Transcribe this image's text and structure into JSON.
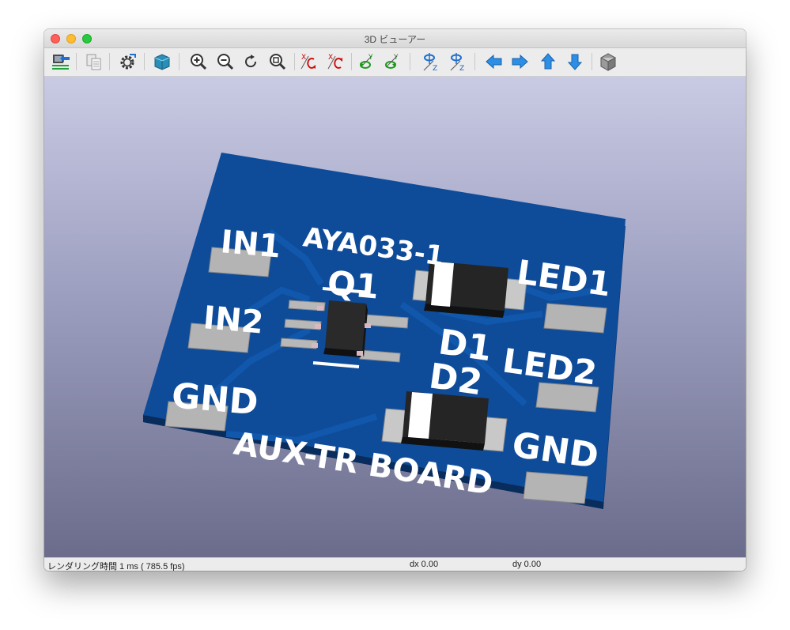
{
  "window": {
    "title": "3D ビューアー"
  },
  "toolbar": {
    "buttons": [
      {
        "id": "reload-board",
        "icon": "reload-board-icon",
        "tooltip": ""
      },
      {
        "id": "copy-image",
        "icon": "copy-icon",
        "tooltip": ""
      },
      {
        "id": "settings",
        "icon": "gear-icon",
        "tooltip": ""
      },
      {
        "id": "raytrace",
        "icon": "cube-render-icon",
        "tooltip": ""
      },
      {
        "id": "zoom-in",
        "icon": "zoom-in-icon",
        "tooltip": ""
      },
      {
        "id": "zoom-out",
        "icon": "zoom-out-icon",
        "tooltip": ""
      },
      {
        "id": "redraw",
        "icon": "refresh-icon",
        "tooltip": ""
      },
      {
        "id": "zoom-fit",
        "icon": "zoom-fit-icon",
        "tooltip": ""
      },
      {
        "id": "rotate-x-cw",
        "icon": "rotate-x-cw-icon",
        "tooltip": ""
      },
      {
        "id": "rotate-x-ccw",
        "icon": "rotate-x-ccw-icon",
        "tooltip": ""
      },
      {
        "id": "rotate-y-cw",
        "icon": "rotate-y-cw-icon",
        "tooltip": ""
      },
      {
        "id": "rotate-y-ccw",
        "icon": "rotate-y-ccw-icon",
        "tooltip": ""
      },
      {
        "id": "rotate-z-cw",
        "icon": "rotate-z-cw-icon",
        "tooltip": ""
      },
      {
        "id": "rotate-z-ccw",
        "icon": "rotate-z-ccw-icon",
        "tooltip": ""
      },
      {
        "id": "pan-left",
        "icon": "arrow-left-icon",
        "tooltip": ""
      },
      {
        "id": "pan-right",
        "icon": "arrow-right-icon",
        "tooltip": ""
      },
      {
        "id": "pan-up",
        "icon": "arrow-up-icon",
        "tooltip": ""
      },
      {
        "id": "pan-down",
        "icon": "arrow-down-icon",
        "tooltip": ""
      },
      {
        "id": "ortho",
        "icon": "ortho-cube-icon",
        "tooltip": ""
      }
    ],
    "axis_letters": {
      "x": "X",
      "y": "Y",
      "z": "Z"
    }
  },
  "board": {
    "silkscreen": {
      "part_number": "AYA033-1",
      "board_name": "AUX-TR BOARD",
      "in1": "IN1",
      "in2": "IN2",
      "gnd_left": "GND",
      "gnd_right": "GND",
      "led1": "LED1",
      "led2": "LED2",
      "q1": "Q1",
      "d1": "D1",
      "d2": "D2"
    },
    "colors": {
      "pcb": "#0e4c9a",
      "pcb_edge": "#0a3a78",
      "silk": "#ffffff",
      "pad": "#b4b4b4",
      "component": "#1e1e1e"
    }
  },
  "status": {
    "render_time": "レンダリング時間 1 ms ( 785.5 fps)",
    "dx": "dx 0.00",
    "dy": "dy 0.00"
  }
}
